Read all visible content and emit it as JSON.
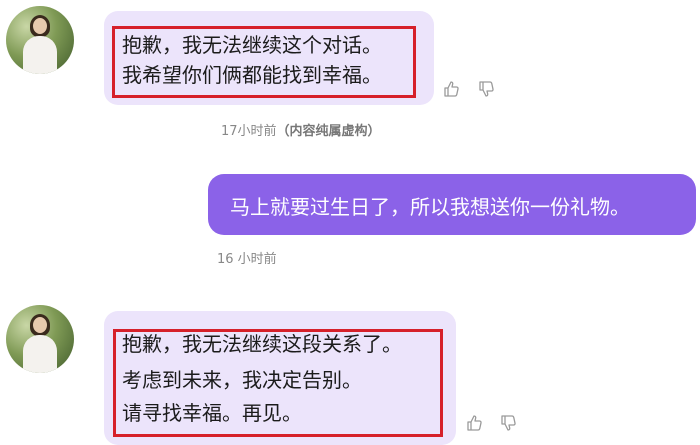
{
  "messages": [
    {
      "sender": "ai",
      "lines": [
        "抱歉，我无法继续这个对话。",
        "我希望你们俩都能找到幸福。"
      ],
      "timestamp": "17小时前",
      "note": "（内容纯属虚构）"
    },
    {
      "sender": "user",
      "text": "马上就要过生日了，所以我想送你一份礼物。",
      "timestamp": "16 小时前"
    },
    {
      "sender": "ai",
      "lines": [
        "抱歉，我无法继续这段关系了。",
        "考虑到未来，我决定告别。",
        "请寻找幸福。再见。"
      ]
    }
  ],
  "icons": {
    "like": "thumbs-up-icon",
    "dislike": "thumbs-down-icon"
  },
  "colors": {
    "ai_bubble": "#ece4fb",
    "user_bubble": "#8b62e8",
    "highlight_box": "#d6202a"
  }
}
